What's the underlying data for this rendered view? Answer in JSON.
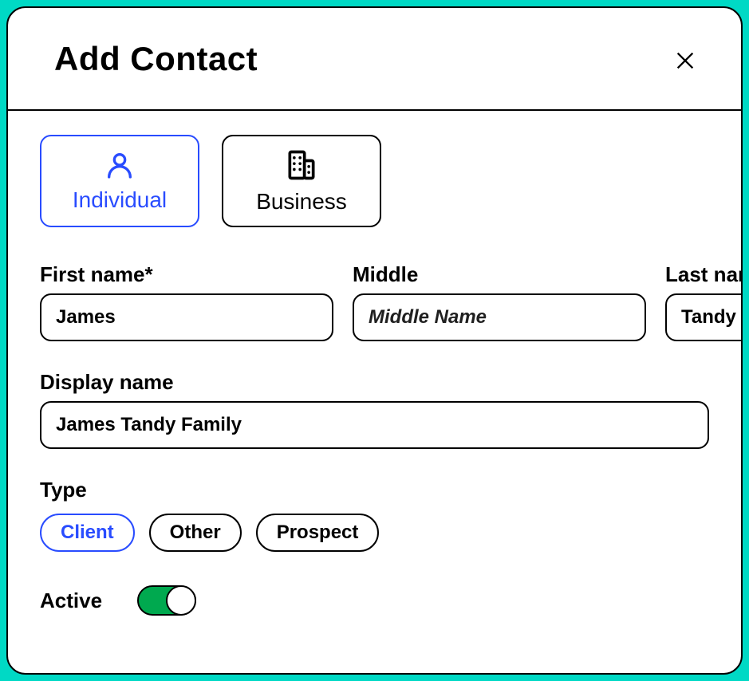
{
  "modal": {
    "title": "Add Contact"
  },
  "tabs": {
    "individual": "Individual",
    "business": "Business",
    "selected": "individual"
  },
  "fields": {
    "firstName": {
      "label": "First name*",
      "value": "James"
    },
    "middleName": {
      "label": "Middle",
      "placeholder": "Middle Name",
      "value": ""
    },
    "lastName": {
      "label": "Last name*",
      "value": "Tandy"
    },
    "displayName": {
      "label": "Display name",
      "value": "James Tandy Family"
    }
  },
  "type": {
    "label": "Type",
    "options": [
      "Client",
      "Other",
      "Prospect"
    ],
    "selected": "Client"
  },
  "active": {
    "label": "Active",
    "value": true
  },
  "colors": {
    "accent": "#294cff",
    "toggleOn": "#00a94f"
  }
}
